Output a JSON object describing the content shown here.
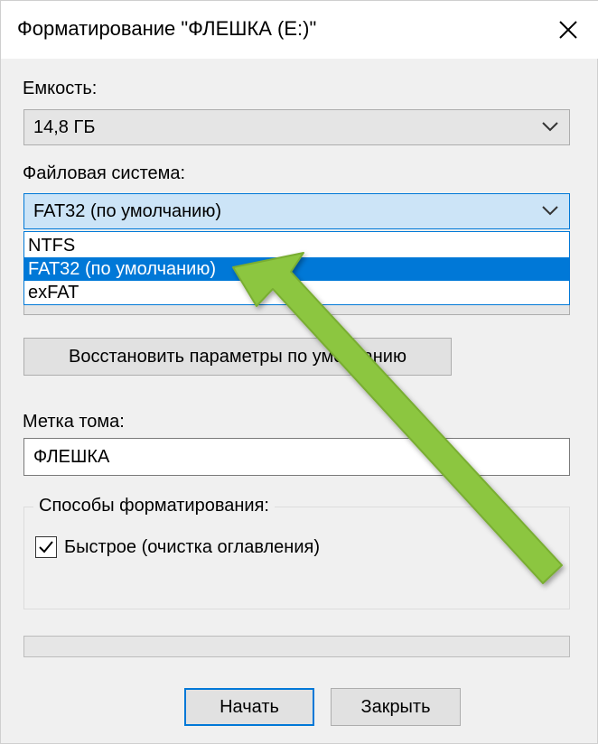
{
  "window": {
    "title": "Форматирование \"ФЛЕШКА (E:)\"",
    "close_icon": "close-icon"
  },
  "capacity": {
    "label": "Емкость:",
    "value": "14,8 ГБ"
  },
  "filesystem": {
    "label": "Файловая система:",
    "value": "FAT32 (по умолчанию)",
    "options": [
      "NTFS",
      "FAT32 (по умолчанию)",
      "exFAT"
    ],
    "selected_index": 1
  },
  "restore_button": {
    "label": "Восстановить параметры по умолчанию"
  },
  "volume_label": {
    "label": "Метка тома:",
    "value": "ФЛЕШКА"
  },
  "format_options": {
    "legend": "Способы форматирования:",
    "quick_label": "Быстрое (очистка оглавления)",
    "quick_checked": true
  },
  "progress": {
    "value": 0
  },
  "buttons": {
    "start": "Начать",
    "close": "Закрыть"
  },
  "colors": {
    "accent": "#0078d7",
    "annotation_arrow": "#8cc63f"
  }
}
